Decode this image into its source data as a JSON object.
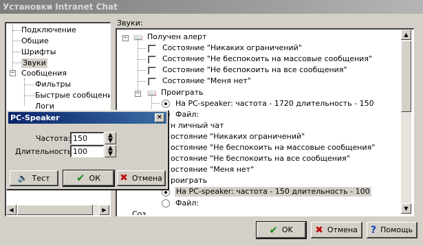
{
  "window": {
    "title": "Установки Intranet Chat"
  },
  "left_tree": {
    "items": [
      "Подключение",
      "Общие",
      "Шрифты",
      "Звуки",
      "Сообщения",
      "Фильтры",
      "Быстрые сообщения",
      "Логи"
    ],
    "selected": "Звуки"
  },
  "sounds_panel": {
    "label": "Звуки:",
    "nodes": {
      "alert_group": "Получен алерт",
      "alert_states": [
        "Состояние \"Никаких ограничений\"",
        "Состояние \"Не беспокоить на массовые сообщения\"",
        "Состояние \"Не беспокоить на все сообщения\"",
        "Состояние \"Меня нет\""
      ],
      "play1": "Проиграть",
      "play1_pc": "На PC-speaker: частота - 1720 длительность - 150",
      "play1_file": "Файл:",
      "private_group_partial": "н личный чат",
      "private_states_partial": [
        "остояние \"Никаких ограничений\"",
        "остояние \"Не беспокоить на массовые сообщения\"",
        "остояние \"Не беспокоить на все сообщения\"",
        "остояние \"Меня нет\""
      ],
      "play2_partial": "роиграть",
      "play2_pc": "На PC-speaker: частота - 150 длительность - 100",
      "play2_file": "Файл:",
      "cutoff": "Соз… …"
    }
  },
  "buttons": {
    "ok": "OK",
    "cancel": "Отмена",
    "help": "Помощь"
  },
  "pc_speaker_dialog": {
    "title": "PC-Speaker",
    "close": "×",
    "frequency_label": "Частота:",
    "frequency_value": "150",
    "duration_label": "Длительность:",
    "duration_value": "100",
    "test_label": "Тест",
    "ok_label": "ОК",
    "cancel_label": "Отмена"
  },
  "icons": {
    "ok": "✔",
    "cancel": "✖",
    "help": "?",
    "book": "📖",
    "speaker": "🔈",
    "spin_up": "▲",
    "spin_down": "▼",
    "arrow_up": "▲",
    "arrow_down": "▼",
    "arrow_left": "◀",
    "arrow_right": "▶",
    "expand": "−"
  }
}
